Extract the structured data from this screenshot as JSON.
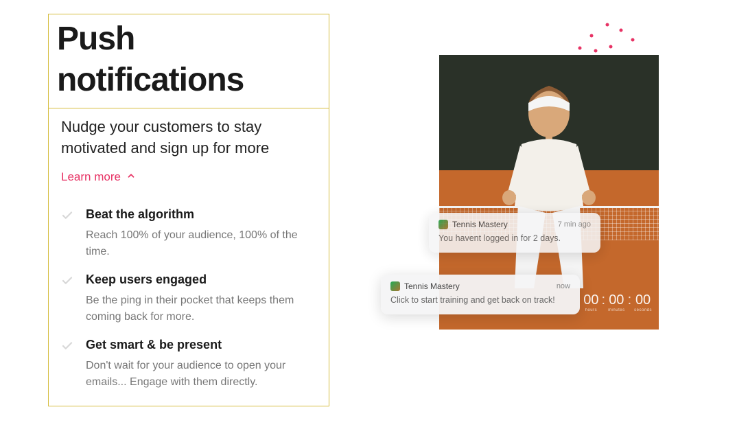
{
  "heading": "Push notifications",
  "subtitle": "Nudge your customers to stay motivated and sign up for more",
  "learn_more": "Learn more",
  "accent": "#e73264",
  "features": [
    {
      "title": "Beat the algorithm",
      "desc": "Reach 100% of your audience, 100% of the time."
    },
    {
      "title": "Keep users engaged",
      "desc": "Be the ping in their pocket that keeps them coming back for more."
    },
    {
      "title": "Get smart & be present",
      "desc": "Don't wait for your audience to open your emails... Engage with them directly."
    }
  ],
  "notifications": [
    {
      "app": "Tennis Mastery",
      "time": "7 min ago",
      "body": "You havent logged in for 2 days."
    },
    {
      "app": "Tennis Mastery",
      "time": "now",
      "body": "Click to start training and get back on track!"
    }
  ],
  "timer": {
    "h": "00",
    "m": "00",
    "s": "00",
    "h_label": "hours",
    "m_label": "minutes",
    "s_label": "seconds"
  }
}
